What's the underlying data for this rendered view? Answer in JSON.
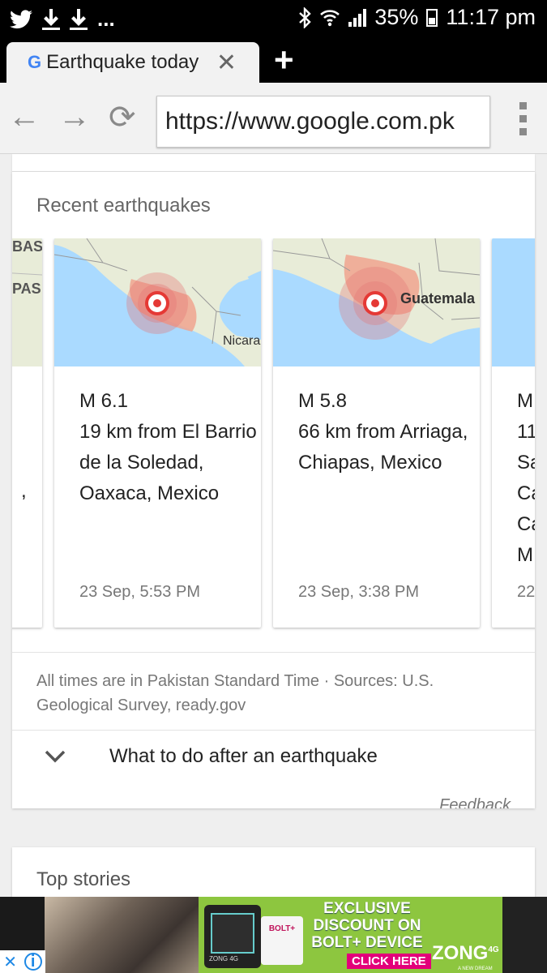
{
  "status_bar": {
    "time": "11:17 pm",
    "battery": "35%",
    "left_icons": [
      "twitter-icon",
      "download-icon",
      "download-icon"
    ],
    "overflow": "...",
    "right_icons": [
      "bluetooth-icon",
      "wifi-icon",
      "signal-icon",
      "battery-icon"
    ]
  },
  "tab": {
    "title": "Earthquake today",
    "logo": "G",
    "close": "✕",
    "new_tab": "+"
  },
  "toolbar": {
    "url": "https://www.google.com.pk",
    "back": "←",
    "forward": "→",
    "reload": "⟳"
  },
  "section": {
    "title": "Recent earthquakes"
  },
  "map_labels": {
    "left_partial_1": "BASC",
    "left_partial_2": "PAS",
    "card1": "Nicara",
    "card2": "Guatemala"
  },
  "earthquakes": [
    {
      "magnitude": "M 6.1",
      "place": "19 km from El Barrio de la Soledad, Oaxaca, Mexico",
      "time": "23 Sep, 5:53 PM"
    },
    {
      "magnitude": "M 5.8",
      "place": "66 km from Arriaga, Chiapas, Mexico",
      "time": "23 Sep, 3:38 PM"
    }
  ],
  "partial_card_right": {
    "lines": [
      "M",
      "11",
      "Sa",
      "Ca",
      "Ca",
      "M"
    ],
    "time": "22"
  },
  "partial_card_left": {
    "comma": ","
  },
  "footnote": "All times are in Pakistan Standard Time · Sources: U.S. Geological Survey, ready.gov",
  "expand": {
    "label": "What to do after an earthquake"
  },
  "feedback": "Feedback",
  "top_stories": {
    "title": "Top stories"
  },
  "ad": {
    "headline": [
      "EXCLUSIVE",
      "DISCOUNT ON",
      "BOLT+ DEVICE"
    ],
    "cta": "CLICK HERE",
    "brand": "ZONG",
    "brand_suffix": "4G",
    "device_label": "BOLT+",
    "device_brand": "ZONG 4G",
    "tagline": "A NEW DREAM",
    "close": "✕",
    "info": "i"
  },
  "colors": {
    "ad_green": "#8dc63f",
    "map_water": "#aadaff",
    "quake_marker": "#e53935",
    "link_blue": "#1e88e5"
  }
}
